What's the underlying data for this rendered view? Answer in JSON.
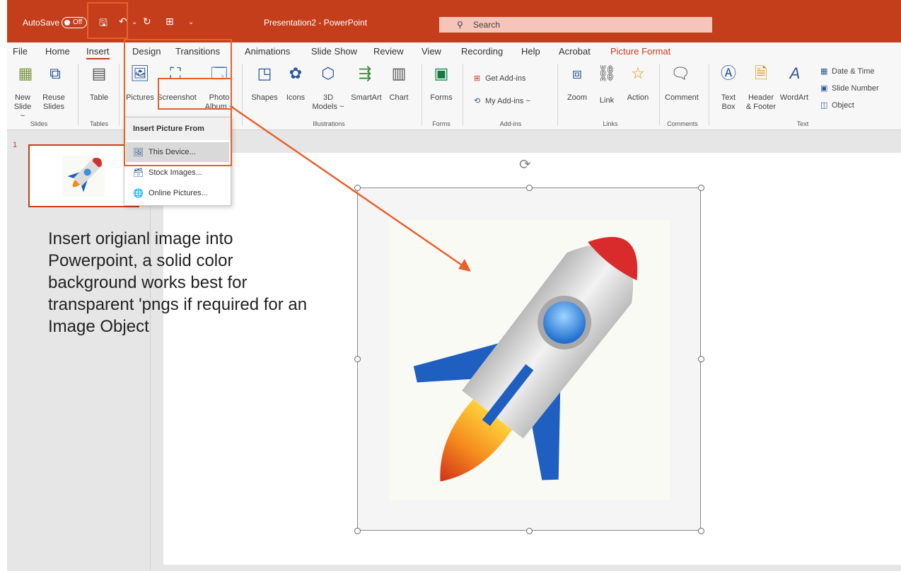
{
  "titlebar": {
    "autosave_label": "AutoSave",
    "autosave_state": "Off",
    "title": "Presentation2 - PowerPoint",
    "search_placeholder": "Search"
  },
  "tabs": [
    "File",
    "Home",
    "Insert",
    "Design",
    "Transitions",
    "Animations",
    "Slide Show",
    "Review",
    "View",
    "Recording",
    "Help",
    "Acrobat",
    "Picture Format"
  ],
  "active_tab": "Insert",
  "ribbon": {
    "new_slide": "New\nSlide ~",
    "reuse_slides": "Reuse\nSlides",
    "table": "Table",
    "pictures": "Pictures",
    "screenshot": "Screenshot",
    "photo_album": "Photo\nAlbum ~",
    "shapes": "Shapes",
    "icons": "Icons",
    "models3d": "3D\nModels ~",
    "smartart": "SmartArt",
    "chart": "Chart",
    "forms": "Forms",
    "get_addins": "Get Add-ins",
    "my_addins": "My Add-ins  ~",
    "zoom": "Zoom",
    "link": "Link",
    "action": "Action",
    "comment": "Comment",
    "text_box": "Text\nBox",
    "header_footer": "Header\n& Footer",
    "wordart": "WordArt",
    "date_time": "Date & Time",
    "slide_number": "Slide Number",
    "object": "Object",
    "groups": {
      "slides": "Slides",
      "tables": "Tables",
      "illustrations": "Illustrations",
      "forms": "Forms",
      "addins": "Add-ins",
      "links": "Links",
      "comments": "Comments",
      "text": "Text"
    }
  },
  "dropdown": {
    "header": "Insert Picture From",
    "items": [
      "This Device...",
      "Stock Images...",
      "Online Pictures..."
    ]
  },
  "slide_number": "1",
  "caption": "Insert origianl image into Powerpoint, a solid color background works best for transparent 'pngs if required for an Image Object",
  "colors": {
    "accent": "#c43e1c",
    "annotation": "#e8602c",
    "image_background": "#fafaf5"
  }
}
